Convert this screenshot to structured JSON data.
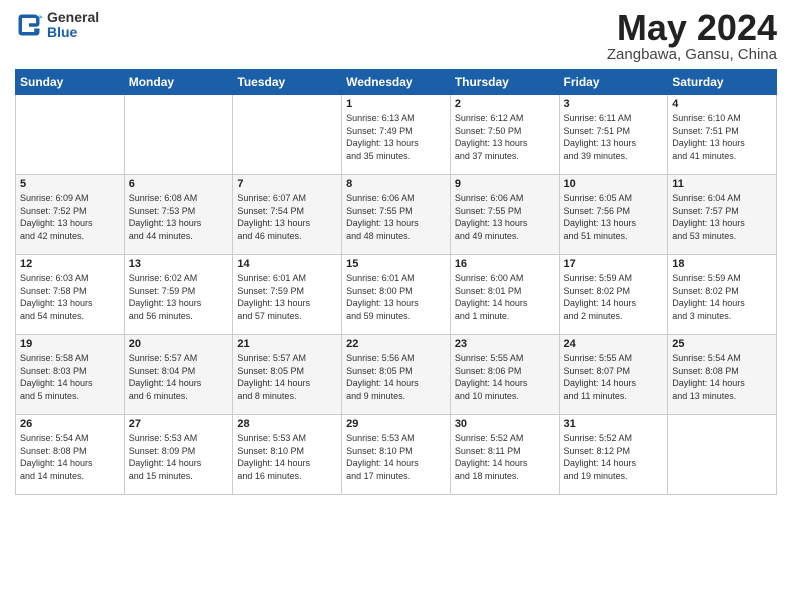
{
  "header": {
    "logo_general": "General",
    "logo_blue": "Blue",
    "title": "May 2024",
    "location": "Zangbawa, Gansu, China"
  },
  "weekdays": [
    "Sunday",
    "Monday",
    "Tuesday",
    "Wednesday",
    "Thursday",
    "Friday",
    "Saturday"
  ],
  "weeks": [
    [
      {
        "day": "",
        "info": ""
      },
      {
        "day": "",
        "info": ""
      },
      {
        "day": "",
        "info": ""
      },
      {
        "day": "1",
        "info": "Sunrise: 6:13 AM\nSunset: 7:49 PM\nDaylight: 13 hours\nand 35 minutes."
      },
      {
        "day": "2",
        "info": "Sunrise: 6:12 AM\nSunset: 7:50 PM\nDaylight: 13 hours\nand 37 minutes."
      },
      {
        "day": "3",
        "info": "Sunrise: 6:11 AM\nSunset: 7:51 PM\nDaylight: 13 hours\nand 39 minutes."
      },
      {
        "day": "4",
        "info": "Sunrise: 6:10 AM\nSunset: 7:51 PM\nDaylight: 13 hours\nand 41 minutes."
      }
    ],
    [
      {
        "day": "5",
        "info": "Sunrise: 6:09 AM\nSunset: 7:52 PM\nDaylight: 13 hours\nand 42 minutes."
      },
      {
        "day": "6",
        "info": "Sunrise: 6:08 AM\nSunset: 7:53 PM\nDaylight: 13 hours\nand 44 minutes."
      },
      {
        "day": "7",
        "info": "Sunrise: 6:07 AM\nSunset: 7:54 PM\nDaylight: 13 hours\nand 46 minutes."
      },
      {
        "day": "8",
        "info": "Sunrise: 6:06 AM\nSunset: 7:55 PM\nDaylight: 13 hours\nand 48 minutes."
      },
      {
        "day": "9",
        "info": "Sunrise: 6:06 AM\nSunset: 7:55 PM\nDaylight: 13 hours\nand 49 minutes."
      },
      {
        "day": "10",
        "info": "Sunrise: 6:05 AM\nSunset: 7:56 PM\nDaylight: 13 hours\nand 51 minutes."
      },
      {
        "day": "11",
        "info": "Sunrise: 6:04 AM\nSunset: 7:57 PM\nDaylight: 13 hours\nand 53 minutes."
      }
    ],
    [
      {
        "day": "12",
        "info": "Sunrise: 6:03 AM\nSunset: 7:58 PM\nDaylight: 13 hours\nand 54 minutes."
      },
      {
        "day": "13",
        "info": "Sunrise: 6:02 AM\nSunset: 7:59 PM\nDaylight: 13 hours\nand 56 minutes."
      },
      {
        "day": "14",
        "info": "Sunrise: 6:01 AM\nSunset: 7:59 PM\nDaylight: 13 hours\nand 57 minutes."
      },
      {
        "day": "15",
        "info": "Sunrise: 6:01 AM\nSunset: 8:00 PM\nDaylight: 13 hours\nand 59 minutes."
      },
      {
        "day": "16",
        "info": "Sunrise: 6:00 AM\nSunset: 8:01 PM\nDaylight: 14 hours\nand 1 minute."
      },
      {
        "day": "17",
        "info": "Sunrise: 5:59 AM\nSunset: 8:02 PM\nDaylight: 14 hours\nand 2 minutes."
      },
      {
        "day": "18",
        "info": "Sunrise: 5:59 AM\nSunset: 8:02 PM\nDaylight: 14 hours\nand 3 minutes."
      }
    ],
    [
      {
        "day": "19",
        "info": "Sunrise: 5:58 AM\nSunset: 8:03 PM\nDaylight: 14 hours\nand 5 minutes."
      },
      {
        "day": "20",
        "info": "Sunrise: 5:57 AM\nSunset: 8:04 PM\nDaylight: 14 hours\nand 6 minutes."
      },
      {
        "day": "21",
        "info": "Sunrise: 5:57 AM\nSunset: 8:05 PM\nDaylight: 14 hours\nand 8 minutes."
      },
      {
        "day": "22",
        "info": "Sunrise: 5:56 AM\nSunset: 8:05 PM\nDaylight: 14 hours\nand 9 minutes."
      },
      {
        "day": "23",
        "info": "Sunrise: 5:55 AM\nSunset: 8:06 PM\nDaylight: 14 hours\nand 10 minutes."
      },
      {
        "day": "24",
        "info": "Sunrise: 5:55 AM\nSunset: 8:07 PM\nDaylight: 14 hours\nand 11 minutes."
      },
      {
        "day": "25",
        "info": "Sunrise: 5:54 AM\nSunset: 8:08 PM\nDaylight: 14 hours\nand 13 minutes."
      }
    ],
    [
      {
        "day": "26",
        "info": "Sunrise: 5:54 AM\nSunset: 8:08 PM\nDaylight: 14 hours\nand 14 minutes."
      },
      {
        "day": "27",
        "info": "Sunrise: 5:53 AM\nSunset: 8:09 PM\nDaylight: 14 hours\nand 15 minutes."
      },
      {
        "day": "28",
        "info": "Sunrise: 5:53 AM\nSunset: 8:10 PM\nDaylight: 14 hours\nand 16 minutes."
      },
      {
        "day": "29",
        "info": "Sunrise: 5:53 AM\nSunset: 8:10 PM\nDaylight: 14 hours\nand 17 minutes."
      },
      {
        "day": "30",
        "info": "Sunrise: 5:52 AM\nSunset: 8:11 PM\nDaylight: 14 hours\nand 18 minutes."
      },
      {
        "day": "31",
        "info": "Sunrise: 5:52 AM\nSunset: 8:12 PM\nDaylight: 14 hours\nand 19 minutes."
      },
      {
        "day": "",
        "info": ""
      }
    ]
  ]
}
